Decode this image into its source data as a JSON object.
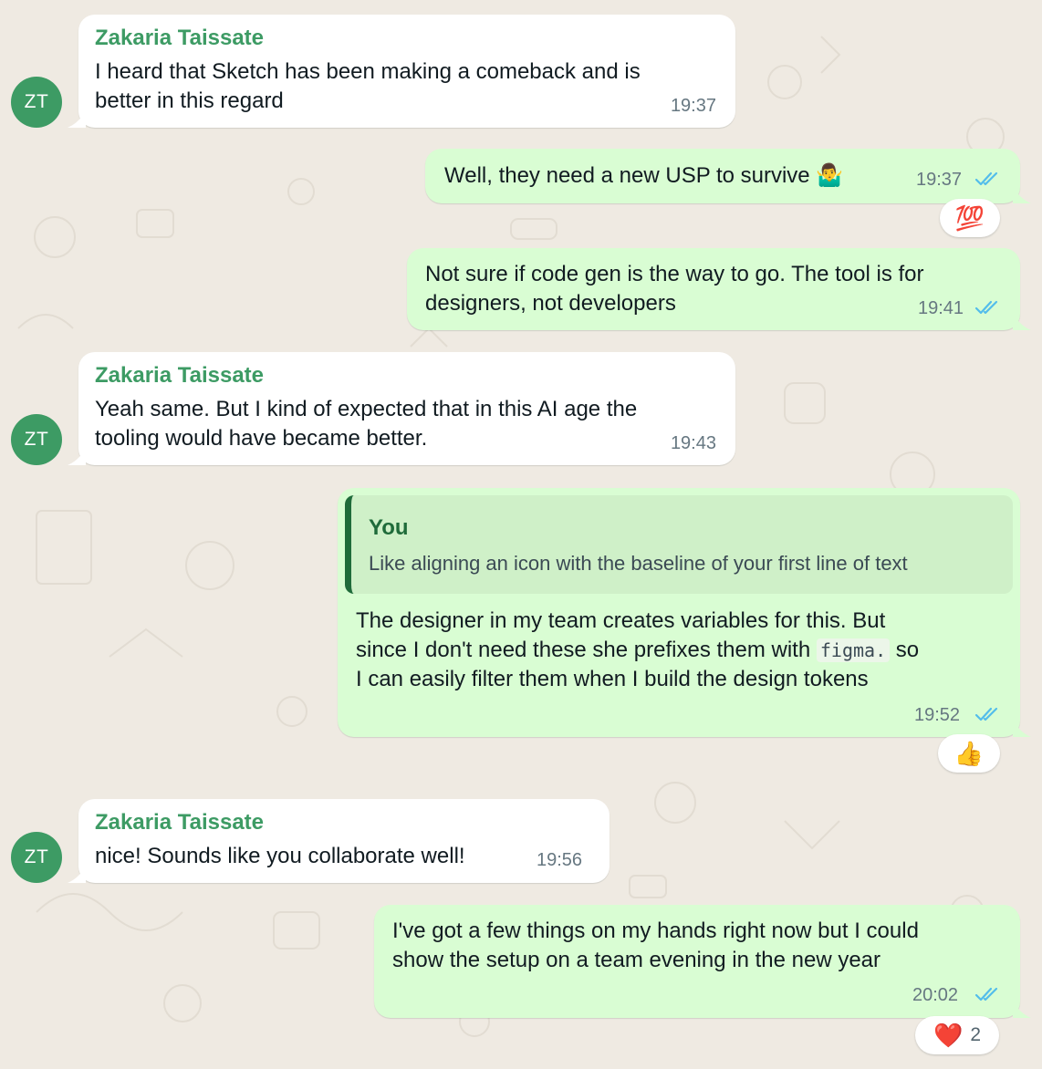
{
  "colors": {
    "background": "#efeae2",
    "incoming_bubble": "#ffffff",
    "outgoing_bubble": "#d9fdd3",
    "sender_name": "#3d9b64",
    "read_ticks": "#53bdeb",
    "timestamp": "#667781"
  },
  "messages": [
    {
      "direction": "incoming",
      "avatar": "ZT",
      "sender": "Zakaria Taissate",
      "lines": [
        "I heard that Sketch has been making a comeback and is",
        "better in this regard"
      ],
      "time": "19:37"
    },
    {
      "direction": "outgoing",
      "lines": [
        "Well, they need a new USP to survive 🤷‍♂️"
      ],
      "time": "19:37",
      "status": "read",
      "reaction": {
        "emoji": "💯",
        "count": ""
      }
    },
    {
      "direction": "outgoing",
      "lines": [
        "Not sure if code gen is the way to go. The tool is for",
        "designers, not developers"
      ],
      "time": "19:41",
      "status": "read"
    },
    {
      "direction": "incoming",
      "avatar": "ZT",
      "sender": "Zakaria Taissate",
      "lines": [
        "Yeah same. But I kind of expected that in this AI age the",
        "tooling would have became better."
      ],
      "time": "19:43"
    },
    {
      "direction": "outgoing",
      "quote": {
        "author": "You",
        "text": "Like aligning an icon with the baseline of your first line of text"
      },
      "lines": [
        "The designer in my team creates variables for this. But",
        "since I don't need these she prefixes them with",
        "I can easily filter them when I build the design tokens"
      ],
      "code": "figma.",
      "code_after": "so",
      "time": "19:52",
      "status": "read",
      "reaction": {
        "emoji": "👍",
        "count": ""
      }
    },
    {
      "direction": "incoming",
      "avatar": "ZT",
      "sender": "Zakaria Taissate",
      "lines": [
        "nice! Sounds like you collaborate well!"
      ],
      "time": "19:56"
    },
    {
      "direction": "outgoing",
      "lines": [
        "I've got a few things on my hands right now but I could",
        "show the setup on a team evening in the new year"
      ],
      "time": "20:02",
      "status": "read",
      "reaction": {
        "emoji": "❤️",
        "count": "2"
      }
    }
  ]
}
